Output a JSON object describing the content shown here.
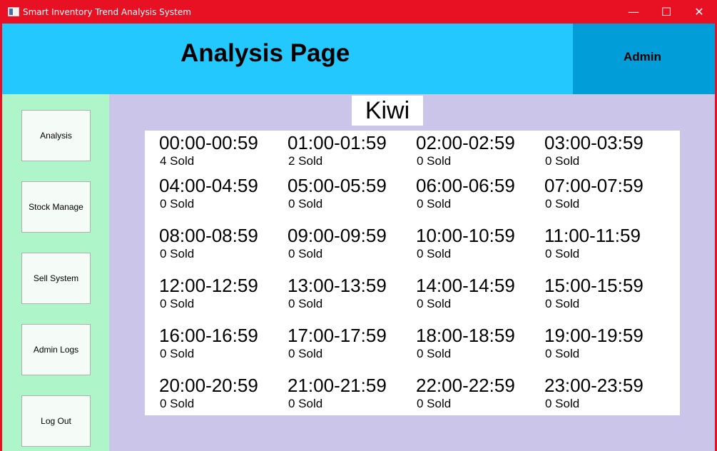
{
  "window": {
    "title": "Smart Inventory Trend Analysis System",
    "minimize_glyph": "—",
    "maximize_glyph": "☐",
    "close_glyph": "✕"
  },
  "header": {
    "title": "Analysis Page",
    "user": "Admin"
  },
  "sidebar": {
    "items": [
      {
        "label": "Analysis"
      },
      {
        "label": "Stock Manage"
      },
      {
        "label": "Sell System"
      },
      {
        "label": "Admin Logs"
      },
      {
        "label": "Log Out"
      }
    ]
  },
  "product": {
    "name": "Kiwi"
  },
  "slots": [
    {
      "time": "00:00-00:59",
      "sold": "4 Sold"
    },
    {
      "time": "01:00-01:59",
      "sold": "2 Sold"
    },
    {
      "time": "02:00-02:59",
      "sold": "0 Sold"
    },
    {
      "time": "03:00-03:59",
      "sold": "0 Sold"
    },
    {
      "time": "04:00-04:59",
      "sold": "0 Sold"
    },
    {
      "time": "05:00-05:59",
      "sold": "0 Sold"
    },
    {
      "time": "06:00-06:59",
      "sold": "0 Sold"
    },
    {
      "time": "07:00-07:59",
      "sold": "0 Sold"
    },
    {
      "time": "08:00-08:59",
      "sold": "0 Sold"
    },
    {
      "time": "09:00-09:59",
      "sold": "0 Sold"
    },
    {
      "time": "10:00-10:59",
      "sold": "0 Sold"
    },
    {
      "time": "11:00-11:59",
      "sold": "0 Sold"
    },
    {
      "time": "12:00-12:59",
      "sold": "0 Sold"
    },
    {
      "time": "13:00-13:59",
      "sold": "0 Sold"
    },
    {
      "time": "14:00-14:59",
      "sold": "0 Sold"
    },
    {
      "time": "15:00-15:59",
      "sold": "0 Sold"
    },
    {
      "time": "16:00-16:59",
      "sold": "0 Sold"
    },
    {
      "time": "17:00-17:59",
      "sold": "0 Sold"
    },
    {
      "time": "18:00-18:59",
      "sold": "0 Sold"
    },
    {
      "time": "19:00-19:59",
      "sold": "0 Sold"
    },
    {
      "time": "20:00-20:59",
      "sold": "0 Sold"
    },
    {
      "time": "21:00-21:59",
      "sold": "0 Sold"
    },
    {
      "time": "22:00-22:59",
      "sold": "0 Sold"
    },
    {
      "time": "23:00-23:59",
      "sold": "0 Sold"
    }
  ],
  "colors": {
    "titlebar": "#e81123",
    "header": "#22c8fe",
    "user_panel": "#009dd8",
    "sidebar": "#aef5c9",
    "main": "#cbc5e9"
  }
}
